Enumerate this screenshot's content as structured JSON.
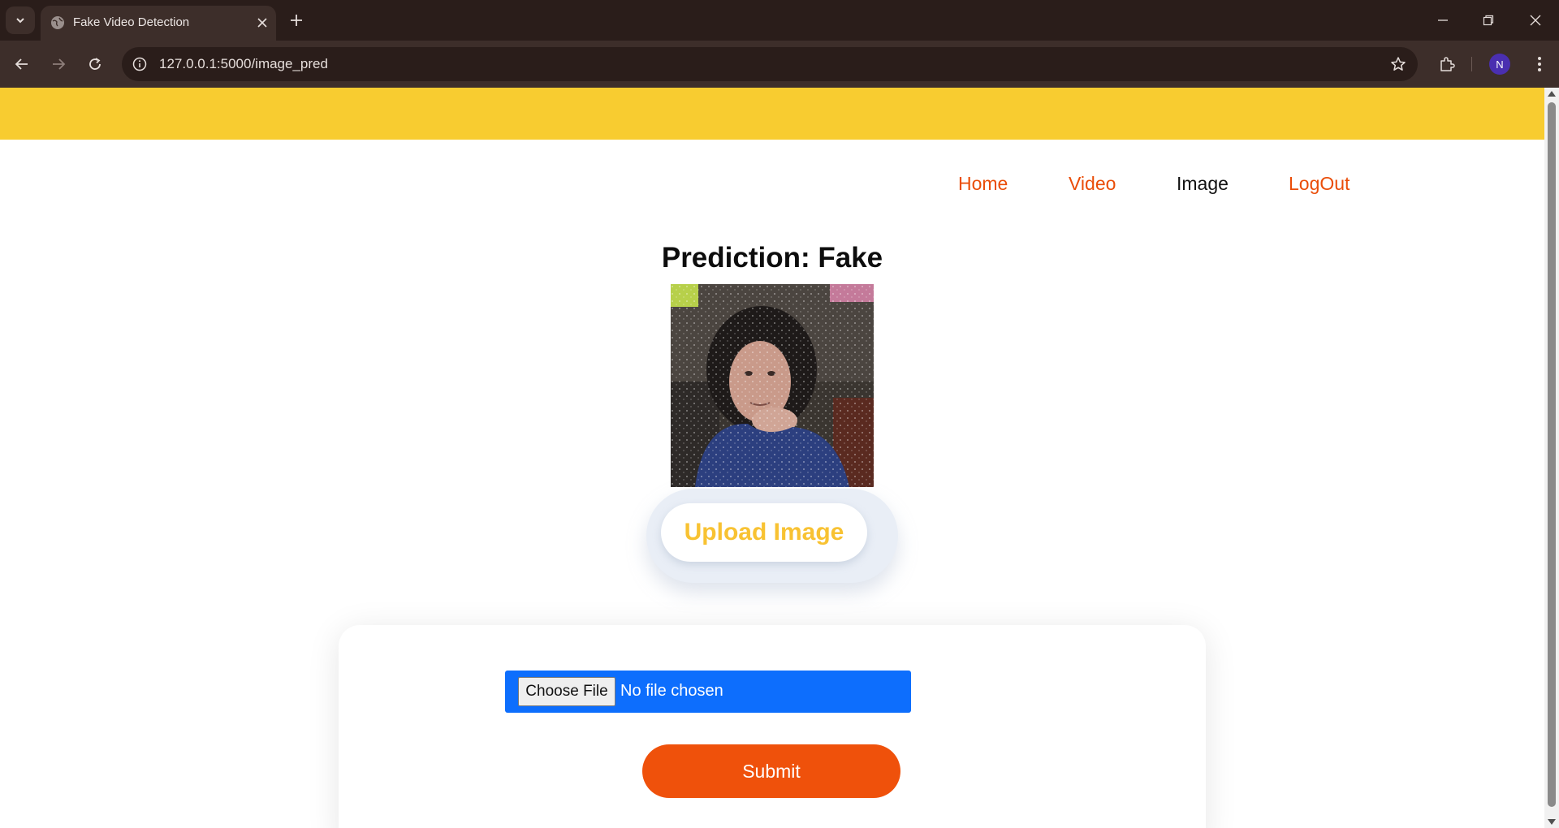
{
  "browser": {
    "tab_title": "Fake Video Detection",
    "url": "127.0.0.1:5000/image_pred",
    "profile_initial": "N"
  },
  "site": {
    "accent_color": "#f8cc30",
    "link_color": "#ea4d08",
    "nav": {
      "home": "Home",
      "video": "Video",
      "image": "Image",
      "logout": "LogOut"
    },
    "prediction": "Prediction: Fake",
    "upload_label": "Upload Image",
    "file_input": {
      "button_label": "Choose File",
      "status": "No file chosen"
    },
    "submit_label": "Submit"
  }
}
